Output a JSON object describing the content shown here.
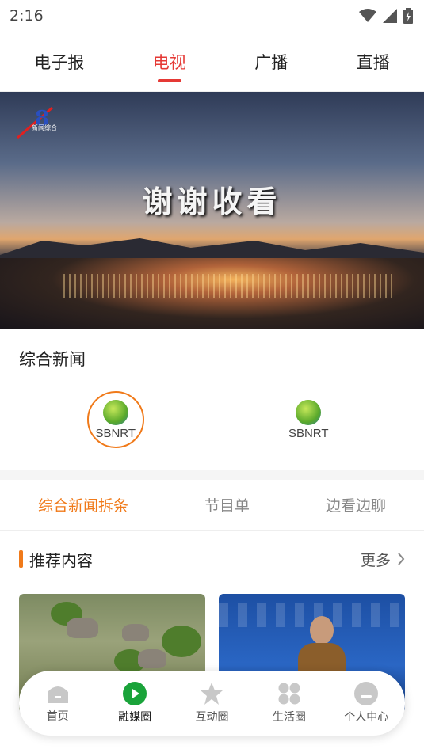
{
  "status_bar": {
    "time": "2:16"
  },
  "top_tabs": [
    {
      "label": "电子报"
    },
    {
      "label": "电视",
      "active": true
    },
    {
      "label": "广播"
    },
    {
      "label": "直播"
    }
  ],
  "video": {
    "title": "谢谢收看",
    "channel_label": "新闻综合"
  },
  "news_section": {
    "title": "综合新闻",
    "channels": [
      {
        "logo_text": "SBNRT",
        "active": true
      },
      {
        "logo_text": "SBNRT",
        "active": false
      }
    ]
  },
  "sub_tabs": [
    {
      "label": "综合新闻拆条",
      "active": true
    },
    {
      "label": "节目单"
    },
    {
      "label": "边看边聊"
    }
  ],
  "recommend": {
    "title": "推荐内容",
    "more": "更多"
  },
  "bottom_nav": [
    {
      "label": "首页",
      "icon": "home-icon"
    },
    {
      "label": "融媒圈",
      "icon": "play-icon",
      "active": true
    },
    {
      "label": "互动圈",
      "icon": "star-icon"
    },
    {
      "label": "生活圈",
      "icon": "grid-icon"
    },
    {
      "label": "个人中心",
      "icon": "person-icon"
    }
  ],
  "colors": {
    "accent_red": "#e53935",
    "accent_orange": "#f07a1a",
    "nav_active_green": "#1aa33a",
    "nav_inactive": "#c8c8c8"
  }
}
